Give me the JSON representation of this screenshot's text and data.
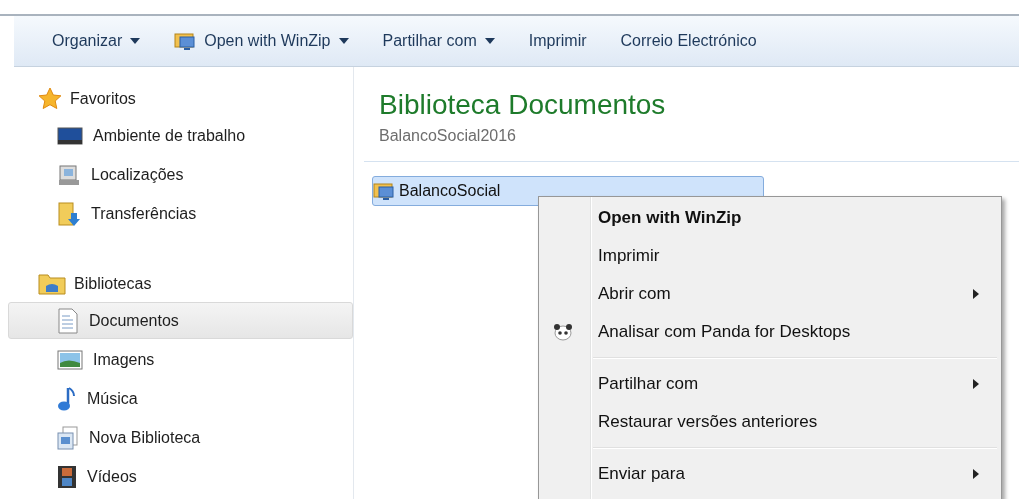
{
  "toolbar": [
    {
      "label": "Organizar",
      "kind": "plain",
      "dropdown": true
    },
    {
      "label": "Open with WinZip",
      "kind": "icon",
      "dropdown": true
    },
    {
      "label": "Partilhar com",
      "kind": "plain",
      "dropdown": true
    },
    {
      "label": "Imprimir",
      "kind": "plain",
      "dropdown": false
    },
    {
      "label": "Correio Electrónico",
      "kind": "plain",
      "dropdown": false
    }
  ],
  "sidebar": {
    "groups": [
      {
        "title": "Favoritos",
        "items": [
          {
            "label": "Ambiente de trabalho",
            "selected": false
          },
          {
            "label": "Localizações",
            "selected": false
          },
          {
            "label": "Transferências",
            "selected": false
          }
        ]
      },
      {
        "title": "Bibliotecas",
        "items": [
          {
            "label": "Documentos",
            "selected": true
          },
          {
            "label": "Imagens",
            "selected": false
          },
          {
            "label": "Música",
            "selected": false
          },
          {
            "label": "Nova Biblioteca",
            "selected": false
          },
          {
            "label": "Vídeos",
            "selected": false
          }
        ]
      }
    ]
  },
  "content": {
    "title": "Biblioteca Documentos",
    "subtitle": "BalancoSocial2016",
    "files": [
      {
        "name": "BalancoSocial",
        "selected": true
      }
    ]
  },
  "context_menu": [
    {
      "kind": "item",
      "label": "Open with WinZip",
      "bold": true,
      "submenu": false,
      "icon": false
    },
    {
      "kind": "item",
      "label": "Imprimir",
      "bold": false,
      "submenu": false,
      "icon": false
    },
    {
      "kind": "item",
      "label": "Abrir com",
      "bold": false,
      "submenu": true,
      "icon": false
    },
    {
      "kind": "item",
      "label": "Analisar com Panda for Desktops",
      "bold": false,
      "submenu": false,
      "icon": true
    },
    {
      "kind": "separator"
    },
    {
      "kind": "item",
      "label": "Partilhar com",
      "bold": false,
      "submenu": true,
      "icon": false
    },
    {
      "kind": "item",
      "label": "Restaurar versões anteriores",
      "bold": false,
      "submenu": false,
      "icon": false
    },
    {
      "kind": "separator"
    },
    {
      "kind": "item",
      "label": "Enviar para",
      "bold": false,
      "submenu": true,
      "icon": false
    }
  ]
}
